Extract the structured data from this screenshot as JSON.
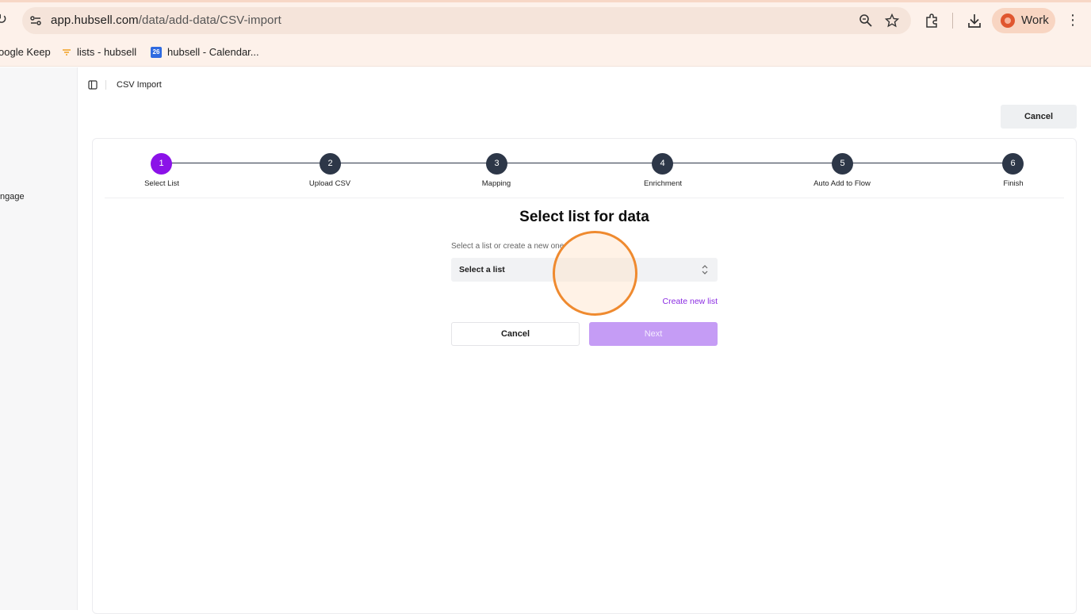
{
  "browser": {
    "url_host": "app.hubsell.com",
    "url_path": "/data/add-data/CSV-import",
    "profile_label": "Work",
    "icons": [
      "reload-icon",
      "site-settings-icon",
      "zoom-icon",
      "bookmark-star-icon",
      "extensions-icon",
      "download-icon",
      "more-icon"
    ],
    "colors": {
      "chrome_bg": "#fdf1ea",
      "profile_bg": "#f8d5c2"
    }
  },
  "bookmarks": [
    {
      "label": "oogle Keep"
    },
    {
      "label": "lists - hubsell"
    },
    {
      "label": "hubsell - Calendar...",
      "badge": "26"
    }
  ],
  "sidebar": {
    "item_label": "ngage"
  },
  "topbar": {
    "breadcrumb": "CSV Import",
    "cancel_label": "Cancel"
  },
  "stepper": {
    "active_step": 1,
    "steps": [
      {
        "number": "1",
        "label": "Select List"
      },
      {
        "number": "2",
        "label": "Upload CSV"
      },
      {
        "number": "3",
        "label": "Mapping"
      },
      {
        "number": "4",
        "label": "Enrichment"
      },
      {
        "number": "5",
        "label": "Auto Add to Flow"
      },
      {
        "number": "6",
        "label": "Finish"
      }
    ],
    "colors": {
      "active": "#8b12e8",
      "inactive": "#2d3748"
    }
  },
  "form": {
    "heading": "Select list for data",
    "field_label": "Select a list or create a new one",
    "select_placeholder": "Select a list",
    "create_link": "Create new list",
    "cancel_label": "Cancel",
    "next_label": "Next",
    "colors": {
      "link": "#8a2be2",
      "next_disabled": "#c59cf5"
    }
  }
}
